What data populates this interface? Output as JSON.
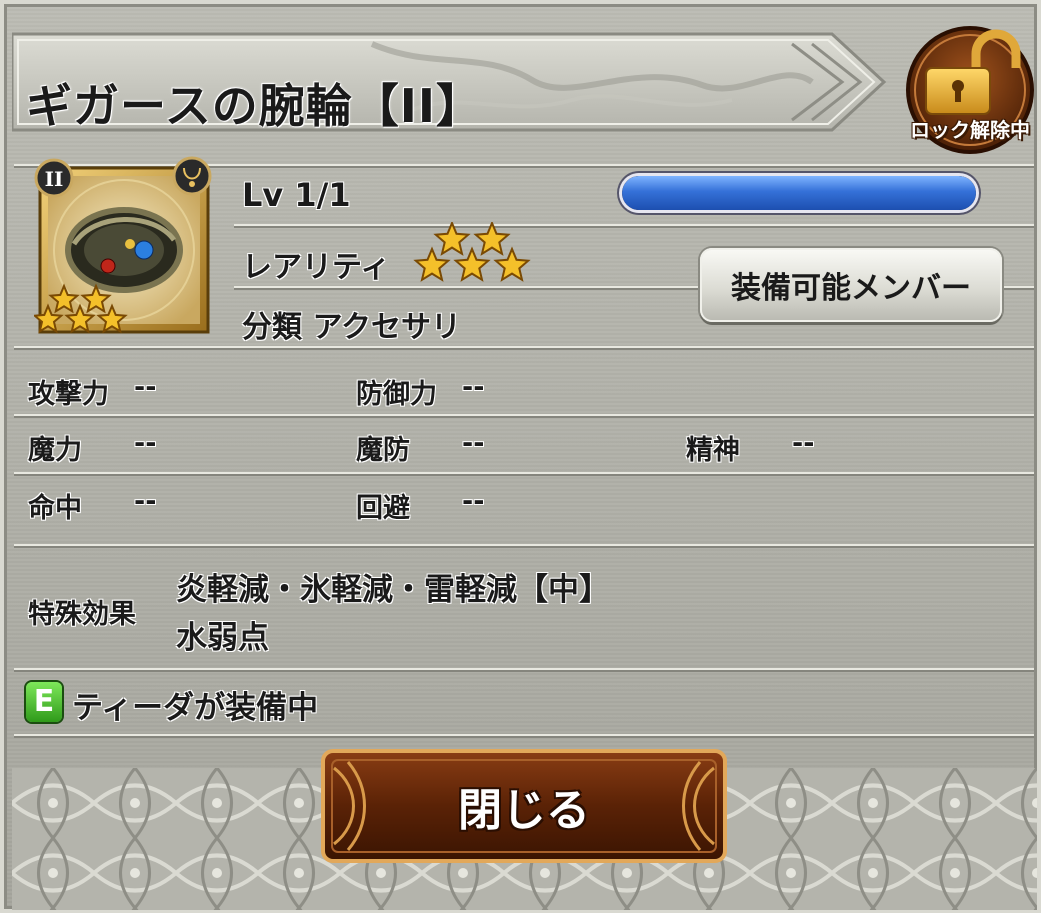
{
  "title": "ギガースの腕輪【II】",
  "lock": {
    "label": "ロック解除中",
    "icon": "unlock-padlock-icon"
  },
  "item": {
    "grade_badge": "II",
    "category_icon": "necklace-icon",
    "image_icon": "bracelet-icon",
    "rarity_stars": 5
  },
  "level": {
    "text": "Lv 1/1",
    "progress": 1.0
  },
  "rarity": {
    "label": "レアリティ",
    "stars": 5
  },
  "equip_member_button": "装備可能メンバー",
  "category": "分類 アクセサリ",
  "stats": {
    "attack": {
      "label": "攻撃力",
      "value": "--"
    },
    "defense": {
      "label": "防御力",
      "value": "--"
    },
    "magic": {
      "label": "魔力",
      "value": "--"
    },
    "magic_defense": {
      "label": "魔防",
      "value": "--"
    },
    "spirit": {
      "label": "精神",
      "value": "--"
    },
    "accuracy": {
      "label": "命中",
      "value": "--"
    },
    "evasion": {
      "label": "回避",
      "value": "--"
    }
  },
  "special_effect": {
    "label": "特殊効果",
    "lines": [
      "炎軽減・氷軽減・雷軽減【中】",
      "水弱点"
    ]
  },
  "equipped": {
    "badge": "E",
    "text": "ティーダが装備中"
  },
  "close_button": "閉じる",
  "colors": {
    "level_bar": "#2f63c9",
    "close_button": "#6a2a0c",
    "lock_badge": "#7a3a12",
    "equipped_badge": "#3fae22"
  }
}
